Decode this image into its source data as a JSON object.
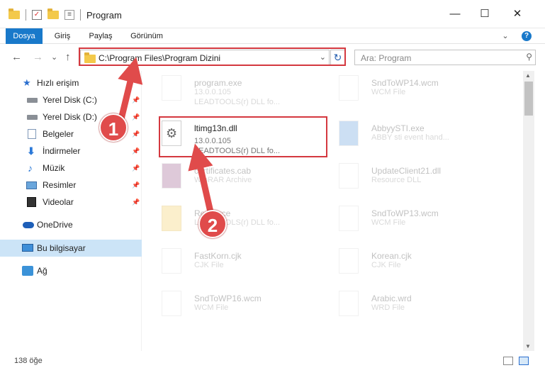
{
  "window": {
    "title": "Program",
    "minimize": "—",
    "maximize": "☐",
    "close": "✕"
  },
  "ribbon": {
    "tabs": [
      "Dosya",
      "Giriş",
      "Paylaş",
      "Görünüm"
    ],
    "expand": "⌄",
    "help": "?"
  },
  "navbar": {
    "back": "←",
    "forward": "→",
    "recent": "⌄",
    "up": "↑",
    "address": "C:\\Program Files\\Program Dizini",
    "address_dropdown": "⌄",
    "refresh": "↻",
    "search_placeholder": "Ara: Program",
    "search_icon": "⚲"
  },
  "sidebar": {
    "items": [
      {
        "label": "Hızlı erişim",
        "icon": "star-icon"
      },
      {
        "label": "Yerel Disk (C:)",
        "icon": "drive-icon",
        "pinned": true
      },
      {
        "label": "Yerel Disk (D:)",
        "icon": "drive-icon",
        "pinned": true
      },
      {
        "label": "Belgeler",
        "icon": "documents-icon",
        "pinned": true
      },
      {
        "label": "İndirmeler",
        "icon": "downloads-icon",
        "pinned": true
      },
      {
        "label": "Müzik",
        "icon": "music-icon",
        "pinned": true
      },
      {
        "label": "Resimler",
        "icon": "pictures-icon",
        "pinned": true
      },
      {
        "label": "Videolar",
        "icon": "videos-icon",
        "pinned": true
      },
      {
        "label": "OneDrive",
        "icon": "onedrive-icon"
      },
      {
        "label": "Bu bilgisayar",
        "icon": "computer-icon",
        "selected": true
      },
      {
        "label": "Ağ",
        "icon": "network-icon"
      }
    ],
    "pin_glyph": "📌"
  },
  "files": [
    {
      "name": "program.exe",
      "line2": "13.0.0.105",
      "line3": "LEADTOOLS(r) DLL fo..."
    },
    {
      "name": "SndToWP14.wcm",
      "line2": "WCM File",
      "line3": ""
    },
    {
      "name": "ltimg13n.dll",
      "line2": "13.0.0.105",
      "line3": "LEADTOOLS(r) DLL fo...",
      "highlighted": true
    },
    {
      "name": "AbbyySTI.exe",
      "line2": "ABBY sti event hand...",
      "line3": ""
    },
    {
      "name": "certificates.cab",
      "line2": "WinRAR Archive",
      "line3": ""
    },
    {
      "name": "UpdateClient21.dll",
      "line2": "Resource DLL",
      "line3": ""
    },
    {
      "name": "Resource",
      "line2": "LEADTOOLS(r) DLL fo...",
      "line3": ""
    },
    {
      "name": "SndToWP13.wcm",
      "line2": "WCM File",
      "line3": ""
    },
    {
      "name": "FastKorn.cjk",
      "line2": "CJK File",
      "line3": ""
    },
    {
      "name": "Korean.cjk",
      "line2": "CJK File",
      "line3": ""
    },
    {
      "name": "SndToWP16.wcm",
      "line2": "WCM File",
      "line3": ""
    },
    {
      "name": "Arabic.wrd",
      "line2": "WRD File",
      "line3": ""
    }
  ],
  "status": {
    "count": "138 öğe"
  },
  "callouts": [
    "1",
    "2"
  ],
  "colors": {
    "accent": "#1979ca",
    "highlight": "#d4383f",
    "callout": "#e04b4b",
    "selected": "#cce4f7"
  }
}
